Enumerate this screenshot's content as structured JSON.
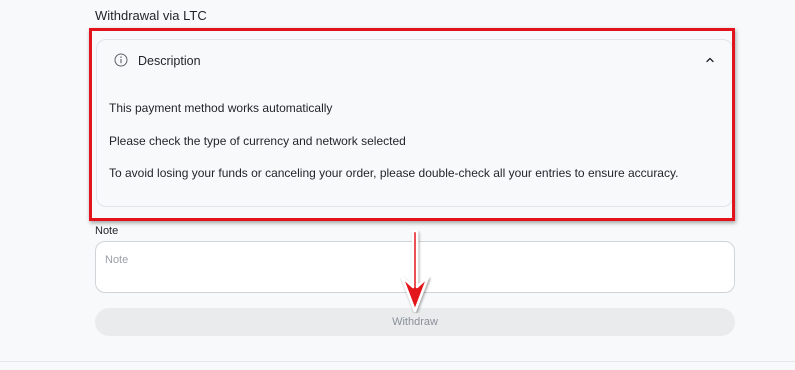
{
  "page": {
    "title": "Withdrawal via LTC"
  },
  "description": {
    "title": "Description",
    "icon": "info-icon",
    "toggle_icon": "chevron-up-icon",
    "lines": [
      "This payment method works automatically",
      "Please check the type of currency and network selected",
      "To avoid losing your funds or canceling your order, please double-check all your entries to ensure accuracy."
    ]
  },
  "note": {
    "label": "Note",
    "value": "",
    "placeholder": "Note"
  },
  "withdraw": {
    "label": "Withdraw"
  },
  "annotation": {
    "highlight_color": "#e3131b",
    "arrow_icon": "down-arrow-icon"
  }
}
